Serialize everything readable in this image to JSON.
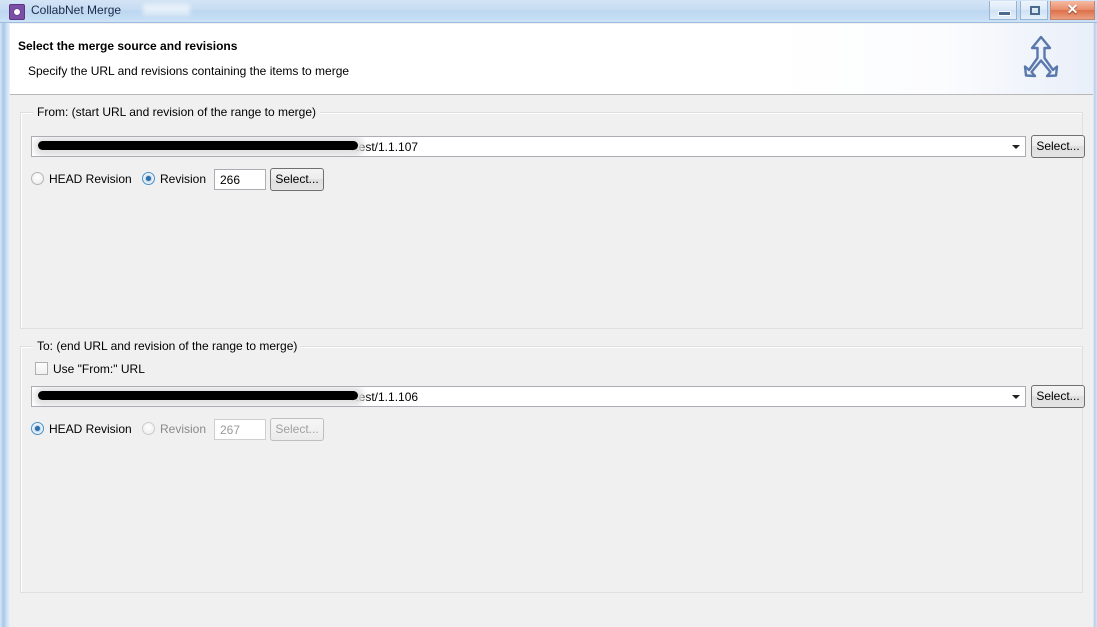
{
  "window": {
    "title": "CollabNet Merge",
    "icon": "collabnet-gear-icon",
    "controls": {
      "minimize": "minimize-button",
      "maximize": "maximize-button",
      "close_glyph": "✕"
    }
  },
  "header": {
    "title": "Select the merge source and revisions",
    "subtitle": "Specify the URL and revisions containing the items to merge",
    "icon": "merge-arrow-icon"
  },
  "from_group": {
    "legend": "From: (start URL and revision of the range to merge)",
    "url_combo": {
      "value": "/test/1.1.107",
      "redacted": true
    },
    "select_url_button": "Select...",
    "head_revision_radio": {
      "label": "HEAD Revision",
      "checked": false,
      "enabled": true
    },
    "revision_radio": {
      "label": "Revision",
      "checked": true,
      "enabled": true
    },
    "revision_value": "266",
    "revision_select_button": "Select..."
  },
  "to_group": {
    "legend": "To: (end URL and revision of the range to merge)",
    "use_from_url_checkbox": {
      "label": "Use \"From:\" URL",
      "checked": false
    },
    "url_combo": {
      "value": "/test/1.1.106",
      "redacted": true
    },
    "select_url_button": "Select...",
    "head_revision_radio": {
      "label": "HEAD Revision",
      "checked": true,
      "enabled": true
    },
    "revision_radio": {
      "label": "Revision",
      "checked": false,
      "enabled": false
    },
    "revision_value": "267",
    "revision_select_button": "Select..."
  },
  "colors": {
    "titlebar_gradient_top": "#d3e4f5",
    "titlebar_gradient_bottom": "#cbe1f6",
    "close_button": "#dd6f48",
    "accent_radio": "#2c70ad",
    "content_bg": "#f0f0f0",
    "icon_purple": "#7b4fa8",
    "merge_icon_blue": "#5b78ad"
  }
}
